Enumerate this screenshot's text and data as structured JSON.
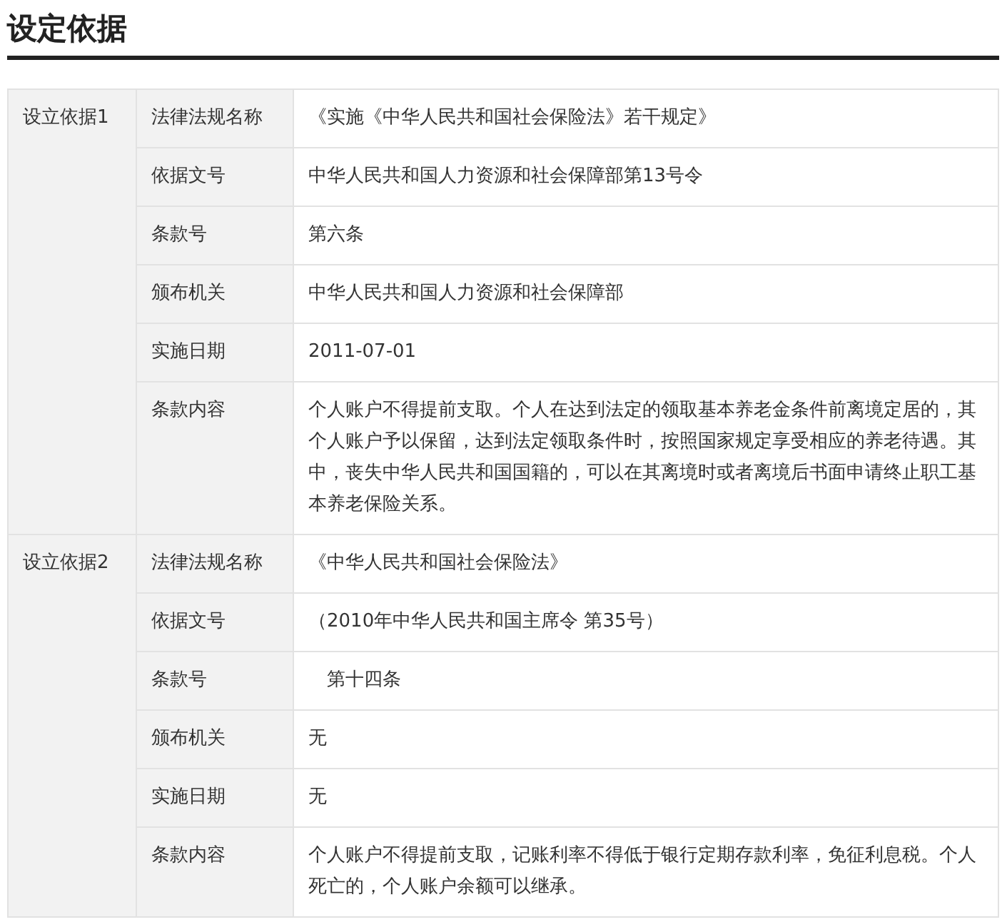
{
  "title": "设定依据",
  "groups": [
    {
      "label": "设立依据1",
      "fields": [
        {
          "name": "法律法规名称",
          "value": "《实施《中华人民共和国社会保险法》若干规定》"
        },
        {
          "name": "依据文号",
          "value": "中华人民共和国人力资源和社会保障部第13号令"
        },
        {
          "name": "条款号",
          "value": "第六条"
        },
        {
          "name": "颁布机关",
          "value": "中华人民共和国人力资源和社会保障部"
        },
        {
          "name": "实施日期",
          "value": "2011-07-01"
        },
        {
          "name": "条款内容",
          "value": "个人账户不得提前支取。个人在达到法定的领取基本养老金条件前离境定居的，其个人账户予以保留，达到法定领取条件时，按照国家规定享受相应的养老待遇。其中，丧失中华人民共和国国籍的，可以在其离境时或者离境后书面申请终止职工基本养老保险关系。"
        }
      ]
    },
    {
      "label": "设立依据2",
      "fields": [
        {
          "name": "法律法规名称",
          "value": "《中华人民共和国社会保险法》"
        },
        {
          "name": "依据文号",
          "value": "（2010年中华人民共和国主席令 第35号）"
        },
        {
          "name": "条款号",
          "value": "　第十四条"
        },
        {
          "name": "颁布机关",
          "value": "无"
        },
        {
          "name": "实施日期",
          "value": "无"
        },
        {
          "name": "条款内容",
          "value": "个人账户不得提前支取，记账利率不得低于银行定期存款利率，免征利息税。个人死亡的，个人账户余额可以继承。"
        }
      ]
    }
  ]
}
